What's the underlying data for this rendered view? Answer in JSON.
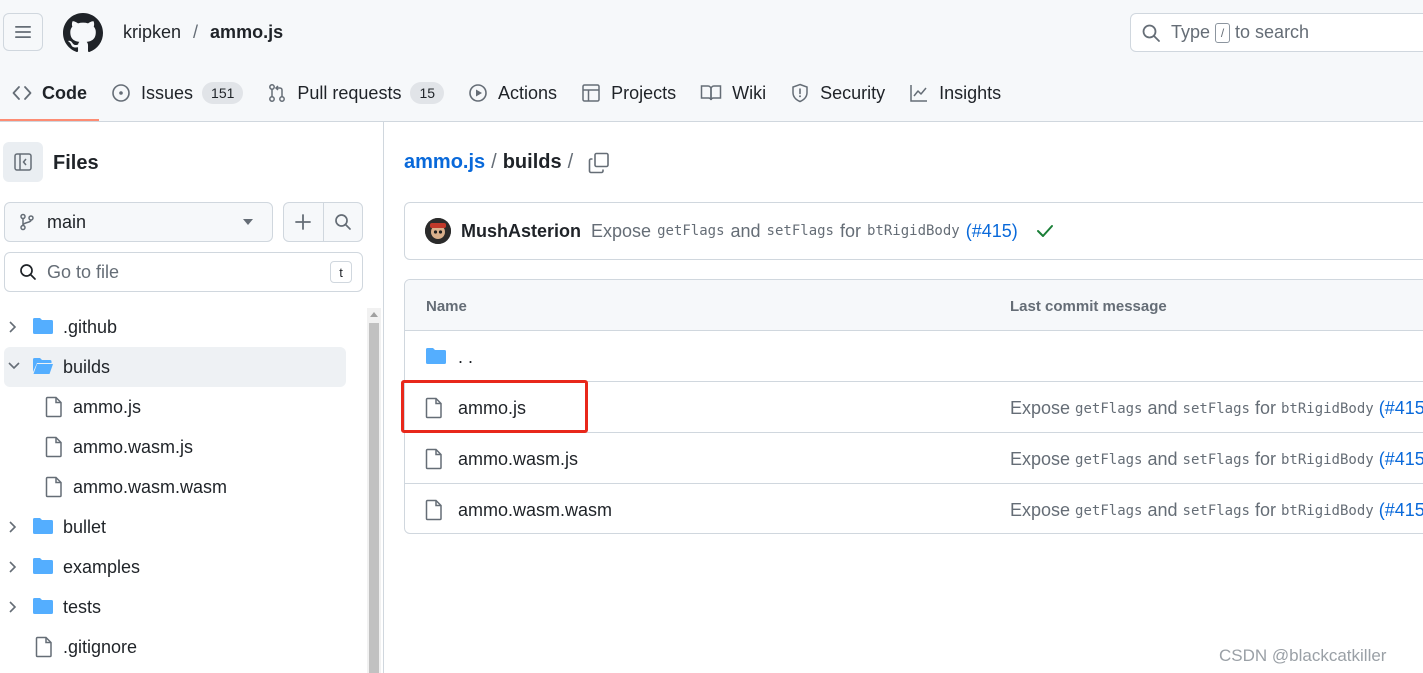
{
  "header": {
    "owner": "kripken",
    "separator": "/",
    "repo": "ammo.js",
    "search": {
      "before": "Type",
      "key": "/",
      "after": "to search"
    }
  },
  "tabs": [
    {
      "id": "code",
      "label": "Code",
      "icon": "code-icon",
      "active": true
    },
    {
      "id": "issues",
      "label": "Issues",
      "icon": "issue-opened-icon",
      "count": "151"
    },
    {
      "id": "pulls",
      "label": "Pull requests",
      "icon": "git-pull-request-icon",
      "count": "15"
    },
    {
      "id": "actions",
      "label": "Actions",
      "icon": "play-icon"
    },
    {
      "id": "projects",
      "label": "Projects",
      "icon": "table-icon"
    },
    {
      "id": "wiki",
      "label": "Wiki",
      "icon": "book-icon"
    },
    {
      "id": "security",
      "label": "Security",
      "icon": "shield-icon"
    },
    {
      "id": "insights",
      "label": "Insights",
      "icon": "graph-icon"
    }
  ],
  "sidebar": {
    "title": "Files",
    "branch": "main",
    "goto_placeholder": "Go to file",
    "goto_shortcut": "t",
    "tree": [
      {
        "name": ".github",
        "type": "dir",
        "expanded": false
      },
      {
        "name": "builds",
        "type": "dir",
        "expanded": true,
        "selected": true
      },
      {
        "name": "ammo.js",
        "type": "file",
        "child": true
      },
      {
        "name": "ammo.wasm.js",
        "type": "file",
        "child": true
      },
      {
        "name": "ammo.wasm.wasm",
        "type": "file",
        "child": true
      },
      {
        "name": "bullet",
        "type": "dir",
        "expanded": false
      },
      {
        "name": "examples",
        "type": "dir",
        "expanded": false
      },
      {
        "name": "tests",
        "type": "dir",
        "expanded": false
      },
      {
        "name": ".gitignore",
        "type": "file"
      }
    ]
  },
  "main": {
    "path_root": "ammo.js",
    "path_current": "builds",
    "path_sep": "/",
    "commit": {
      "author": "MushAsterion",
      "msg_expose": "Expose",
      "code1": "getFlags",
      "msg_and": "and",
      "code2": "setFlags",
      "msg_for": "for",
      "code3": "btRigidBody",
      "pr_open": "(",
      "pr": "#415",
      "pr_close": ")"
    },
    "table": {
      "col_name": "Name",
      "col_commit": "Last commit message",
      "parent_label": ". .",
      "rows": [
        {
          "name": "ammo.js",
          "highlighted": true
        },
        {
          "name": "ammo.wasm.js"
        },
        {
          "name": "ammo.wasm.wasm"
        }
      ]
    }
  },
  "watermark": "CSDN @blackcatkiller",
  "colors": {
    "accent_link": "#0969da",
    "folder": "#54aeff",
    "tab_underline": "#fd8c73",
    "highlight": "#e8281b",
    "success": "#1a7f37"
  }
}
